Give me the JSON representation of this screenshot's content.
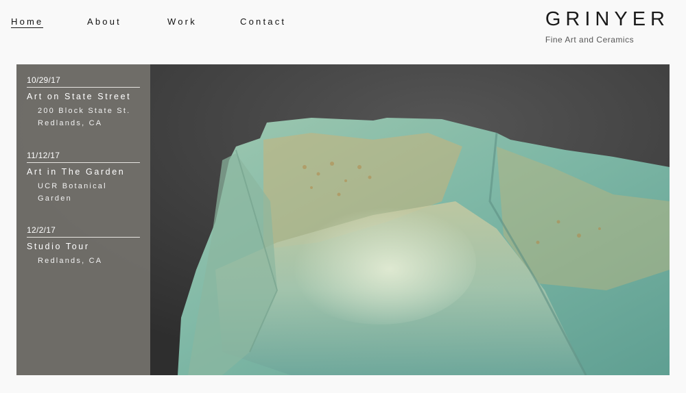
{
  "nav": {
    "items": [
      {
        "label": "Home",
        "active": true
      },
      {
        "label": "About",
        "active": false
      },
      {
        "label": "Work",
        "active": false
      },
      {
        "label": "Contact",
        "active": false
      }
    ]
  },
  "brand": {
    "name": "GRINYER",
    "tagline": "Fine Art and Ceramics"
  },
  "events": [
    {
      "date": "10/29/17",
      "title": "Art on State Street",
      "location": [
        "200 Block State St.",
        "Redlands, CA"
      ]
    },
    {
      "date": "11/12/17",
      "title": "Art in The Garden",
      "location": [
        "UCR Botanical",
        "Garden"
      ]
    },
    {
      "date": "12/2/17",
      "title": "Studio Tour",
      "location": [
        "Redlands, CA"
      ]
    }
  ],
  "hero": {
    "image": "turquoise-ceramic-vessel",
    "colors": {
      "glaze": "#8fc1ae",
      "ochre": "#c9b27a",
      "background": "#3e3e3e"
    }
  }
}
